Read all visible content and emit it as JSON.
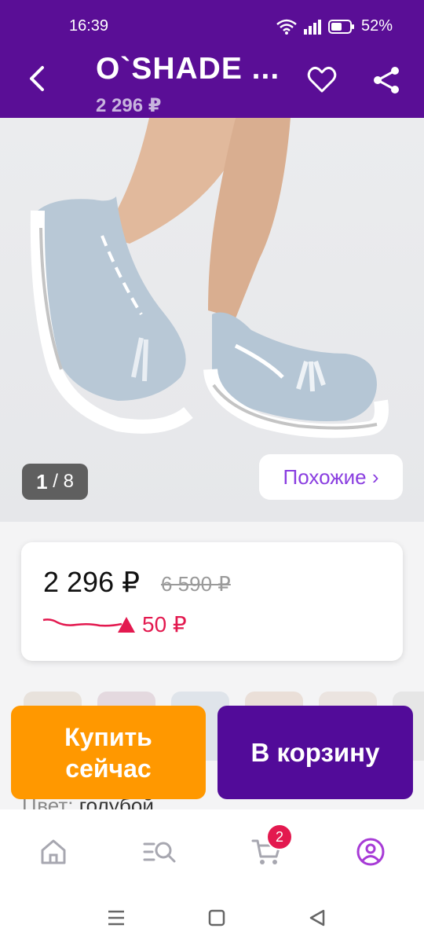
{
  "status_bar": {
    "time": "16:39",
    "battery": "52%"
  },
  "header": {
    "title": "O`SHADE ...",
    "price": "2 296 ₽"
  },
  "gallery": {
    "counter_current": "1",
    "counter_sep": " / ",
    "counter_total": "8",
    "similar_label": "Похожие ›"
  },
  "price_card": {
    "current": "2 296 ₽",
    "old": "6 590 ₽",
    "change": "50 ₽"
  },
  "actions": {
    "buy_now": "Купить сейчас",
    "to_cart": "В корзину"
  },
  "product": {
    "color_label": "Цвет:",
    "color_value": "голубой"
  },
  "bottom_nav": {
    "items": [
      {
        "icon": "home-icon"
      },
      {
        "icon": "catalog-search-icon"
      },
      {
        "icon": "cart-icon"
      },
      {
        "icon": "profile-icon"
      }
    ],
    "cart_badge": "2",
    "active_color": "#a73bd6",
    "inactive_color": "#a7a7b0"
  },
  "colors": {
    "brand": "#5a0e96",
    "buy_now": "#ff9800",
    "cart": "#520b99",
    "accent": "#e3194f"
  }
}
